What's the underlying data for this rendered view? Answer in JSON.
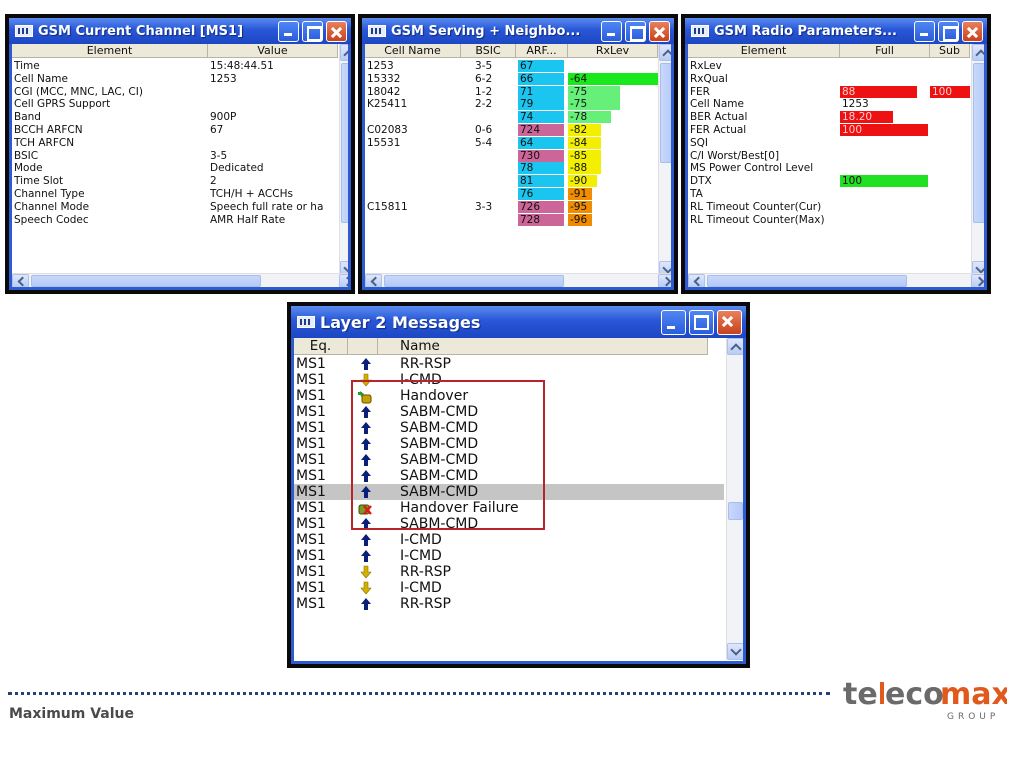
{
  "win1": {
    "title": "GSM Current Channel [MS1]",
    "col_element": "Element",
    "col_value": "Value",
    "rows": [
      {
        "e": "Time",
        "v": "15:48:44.51"
      },
      {
        "e": "Cell Name",
        "v": "1253"
      },
      {
        "e": "CGI (MCC, MNC, LAC, CI)",
        "v": ""
      },
      {
        "e": "Cell GPRS Support",
        "v": ""
      },
      {
        "e": "Band",
        "v": "900P"
      },
      {
        "e": "BCCH ARFCN",
        "v": "67"
      },
      {
        "e": "TCH ARFCN",
        "v": ""
      },
      {
        "e": "BSIC",
        "v": "3-5"
      },
      {
        "e": "Mode",
        "v": "Dedicated"
      },
      {
        "e": "Time Slot",
        "v": "2"
      },
      {
        "e": "Channel Type",
        "v": "TCH/H + ACCHs"
      },
      {
        "e": "Channel Mode",
        "v": "Speech full rate or ha"
      },
      {
        "e": "Speech Codec",
        "v": "AMR Half Rate"
      }
    ]
  },
  "win2": {
    "title": "GSM Serving + Neighbo...",
    "col_cell": "Cell Name",
    "col_bsic": "BSIC",
    "col_arf": "ARF...",
    "col_rxlev": "RxLev",
    "rows": [
      {
        "cell": "1253",
        "bsic": "3-5",
        "arf": "67",
        "rx": "",
        "arfc": "#1ac6f0",
        "rxc": "",
        "rxw": 0
      },
      {
        "cell": "15332",
        "bsic": "6-2",
        "arf": "66",
        "rx": "-64",
        "arfc": "#1ac6f0",
        "rxc": "#19e81c",
        "rxw": 1
      },
      {
        "cell": "18042",
        "bsic": "1-2",
        "arf": "71",
        "rx": "-75",
        "arfc": "#1ac6f0",
        "rxc": "#66f07a",
        "rxw": 0.55
      },
      {
        "cell": "K25411",
        "bsic": "2-2",
        "arf": "79",
        "rx": "-75",
        "arfc": "#1ac6f0",
        "rxc": "#66f07a",
        "rxw": 0.55
      },
      {
        "cell": "",
        "bsic": "",
        "arf": "74",
        "rx": "-78",
        "arfc": "#1ac6f0",
        "rxc": "#66f07a",
        "rxw": 0.45
      },
      {
        "cell": "C02083",
        "bsic": "0-6",
        "arf": "724",
        "rx": "-82",
        "arfc": "#cc6699",
        "rxc": "#f2f000",
        "rxw": 0.35
      },
      {
        "cell": "15531",
        "bsic": "5-4",
        "arf": "64",
        "rx": "-84",
        "arfc": "#1ac6f0",
        "rxc": "#f2f000",
        "rxw": 0.35
      },
      {
        "cell": "",
        "bsic": "",
        "arf": "730",
        "rx": "-85",
        "arfc": "#cc6699",
        "rxc": "#f2f000",
        "rxw": 0.35
      },
      {
        "cell": "",
        "bsic": "",
        "arf": "78",
        "rx": "-88",
        "arfc": "#1ac6f0",
        "rxc": "#f2f000",
        "rxw": 0.35
      },
      {
        "cell": "",
        "bsic": "",
        "arf": "81",
        "rx": "-90",
        "arfc": "#1ac6f0",
        "rxc": "#f2f000",
        "rxw": 0.3
      },
      {
        "cell": "",
        "bsic": "",
        "arf": "76",
        "rx": "-91",
        "arfc": "#1ac6f0",
        "rxc": "#f08c00",
        "rxw": 0.25
      },
      {
        "cell": "C15811",
        "bsic": "3-3",
        "arf": "726",
        "rx": "-95",
        "arfc": "#cc6699",
        "rxc": "#f08c00",
        "rxw": 0.25
      },
      {
        "cell": "",
        "bsic": "",
        "arf": "728",
        "rx": "-96",
        "arfc": "#cc6699",
        "rxc": "#f08c00",
        "rxw": 0.25
      }
    ]
  },
  "win3": {
    "title": "GSM Radio Parameters...",
    "col_element": "Element",
    "col_full": "Full",
    "col_sub": "Sub",
    "rows": [
      {
        "e": "RxLev",
        "f": "",
        "fc": "",
        "fw": 0,
        "s": "",
        "sc": ""
      },
      {
        "e": "RxQual",
        "f": "",
        "fc": "",
        "fw": 0,
        "s": "",
        "sc": ""
      },
      {
        "e": "FER",
        "f": "88",
        "fc": "#ee1111",
        "fw": 0.88,
        "s": "100",
        "sc": "#ee1111"
      },
      {
        "e": "Cell Name",
        "f": "1253",
        "fc": "",
        "fw": 0,
        "s": "",
        "sc": ""
      },
      {
        "e": "BER Actual",
        "f": "18.20",
        "fc": "#ee1111",
        "fw": 0.6,
        "s": "",
        "sc": ""
      },
      {
        "e": "FER Actual",
        "f": "100",
        "fc": "#ee1111",
        "fw": 1,
        "s": "",
        "sc": ""
      },
      {
        "e": "SQI",
        "f": "",
        "fc": "",
        "fw": 0,
        "s": "",
        "sc": ""
      },
      {
        "e": "C/I Worst/Best[0]",
        "f": "",
        "fc": "",
        "fw": 0,
        "s": "",
        "sc": ""
      },
      {
        "e": "MS Power Control Level",
        "f": "",
        "fc": "",
        "fw": 0,
        "s": "",
        "sc": ""
      },
      {
        "e": "DTX",
        "f": "100",
        "fc": "#22e022",
        "fw": 1,
        "s": "",
        "sc": ""
      },
      {
        "e": "TA",
        "f": "",
        "fc": "",
        "fw": 0,
        "s": "",
        "sc": ""
      },
      {
        "e": "RL Timeout Counter(Cur)",
        "f": "",
        "fc": "",
        "fw": 0,
        "s": "",
        "sc": ""
      },
      {
        "e": "RL Timeout Counter(Max)",
        "f": "",
        "fc": "",
        "fw": 0,
        "s": "",
        "sc": ""
      }
    ]
  },
  "win4": {
    "title": "Layer 2 Messages",
    "col_eq": "Eq.",
    "col_name": "Name",
    "rows": [
      {
        "eq": "MS1",
        "icon": "up-arrow-icon",
        "name": "RR-RSP"
      },
      {
        "eq": "MS1",
        "icon": "down-arrow-icon",
        "name": "I-CMD"
      },
      {
        "eq": "MS1",
        "icon": "handover-icon",
        "name": "Handover"
      },
      {
        "eq": "MS1",
        "icon": "up-arrow-icon",
        "name": "SABM-CMD"
      },
      {
        "eq": "MS1",
        "icon": "up-arrow-icon",
        "name": "SABM-CMD"
      },
      {
        "eq": "MS1",
        "icon": "up-arrow-icon",
        "name": "SABM-CMD"
      },
      {
        "eq": "MS1",
        "icon": "up-arrow-icon",
        "name": "SABM-CMD"
      },
      {
        "eq": "MS1",
        "icon": "up-arrow-icon",
        "name": "SABM-CMD"
      },
      {
        "eq": "MS1",
        "icon": "up-arrow-icon",
        "name": "SABM-CMD",
        "selected": true
      },
      {
        "eq": "MS1",
        "icon": "handover-failure-icon",
        "name": "Handover Failure"
      },
      {
        "eq": "MS1",
        "icon": "up-arrow-icon",
        "name": "SABM-CMD"
      },
      {
        "eq": "MS1",
        "icon": "up-arrow-icon",
        "name": "I-CMD"
      },
      {
        "eq": "MS1",
        "icon": "up-arrow-icon",
        "name": "I-CMD"
      },
      {
        "eq": "MS1",
        "icon": "down-arrow-icon",
        "name": "RR-RSP"
      },
      {
        "eq": "MS1",
        "icon": "down-arrow-icon",
        "name": "I-CMD"
      },
      {
        "eq": "MS1",
        "icon": "up-arrow-icon",
        "name": "RR-RSP"
      }
    ]
  },
  "footer": {
    "label": "Maximum Value"
  },
  "logo": {
    "text_a": "te",
    "text_b": "eco",
    "text_c": "max",
    "sub": "GROUP"
  },
  "colors": {
    "titlebar": "#2957d8",
    "highlight_box": "#b8242a",
    "up_arrow": "#0a1f7a",
    "down_arrow": "#d4b000"
  }
}
